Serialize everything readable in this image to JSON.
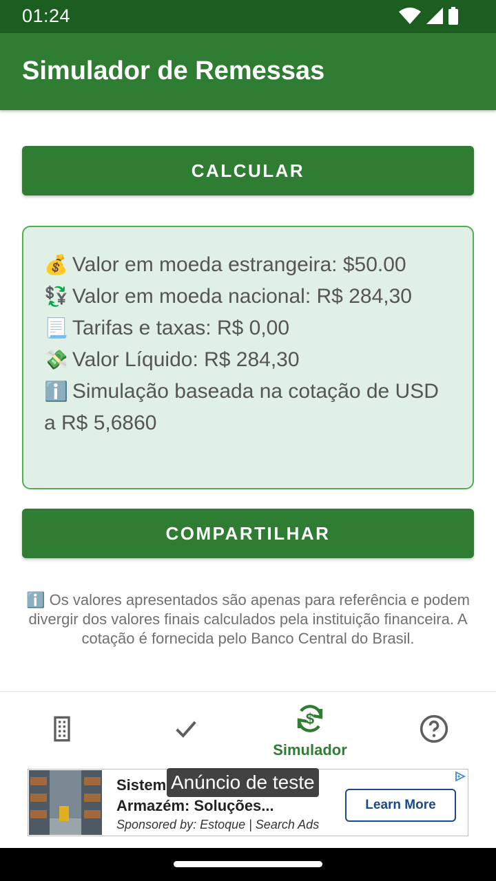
{
  "status_bar": {
    "time": "01:24",
    "icons": [
      "wifi-icon",
      "signal-icon",
      "battery-icon"
    ]
  },
  "app_bar": {
    "title": "Simulador de Remessas"
  },
  "actions": {
    "calculate_label": "CALCULAR",
    "share_label": "COMPARTILHAR"
  },
  "result": {
    "foreign_value": {
      "icon": "money-bag-emoji",
      "text": "Valor em moeda estrangeira: $50.00"
    },
    "national_value": {
      "icon": "currency-exchange-emoji",
      "text": "Valor em moeda nacional: R$ 284,30"
    },
    "fees": {
      "icon": "receipt-emoji",
      "text": "Tarifas e taxas: R$ 0,00"
    },
    "net_value": {
      "icon": "money-wings-emoji",
      "text": "Valor Líquido: R$ 284,30"
    },
    "rate_note": {
      "icon": "info-emoji",
      "text": "Simulação baseada na cotação de USD a R$ 5,6860"
    }
  },
  "disclaimer": {
    "icon": "info-emoji",
    "text": "Os valores apresentados são apenas para referência e podem divergir dos valores finais calculados pela instituição financeira. A cotação é fornecida pelo Banco Central do Brasil."
  },
  "bottom_nav": {
    "items": [
      {
        "icon": "building-icon",
        "label": ""
      },
      {
        "icon": "check-icon",
        "label": ""
      },
      {
        "icon": "currency-exchange-icon",
        "label": "Simulador",
        "active": true
      },
      {
        "icon": "help-icon",
        "label": ""
      }
    ]
  },
  "ad": {
    "test_label": "Anúncio de teste",
    "headline": "Sistem... Armazém: Soluções...",
    "headline_line1": "Sistem",
    "headline_line2": "Armazém: Soluções...",
    "sponsor": "Sponsored by: Estoque | Search Ads",
    "cta_label": "Learn More"
  },
  "colors": {
    "primary": "#2e7d32",
    "primary_dark": "#1b5e20",
    "card_bg": "#e0f0e6",
    "card_border": "#4caf50",
    "ad_cta": "#1a4a8a"
  }
}
